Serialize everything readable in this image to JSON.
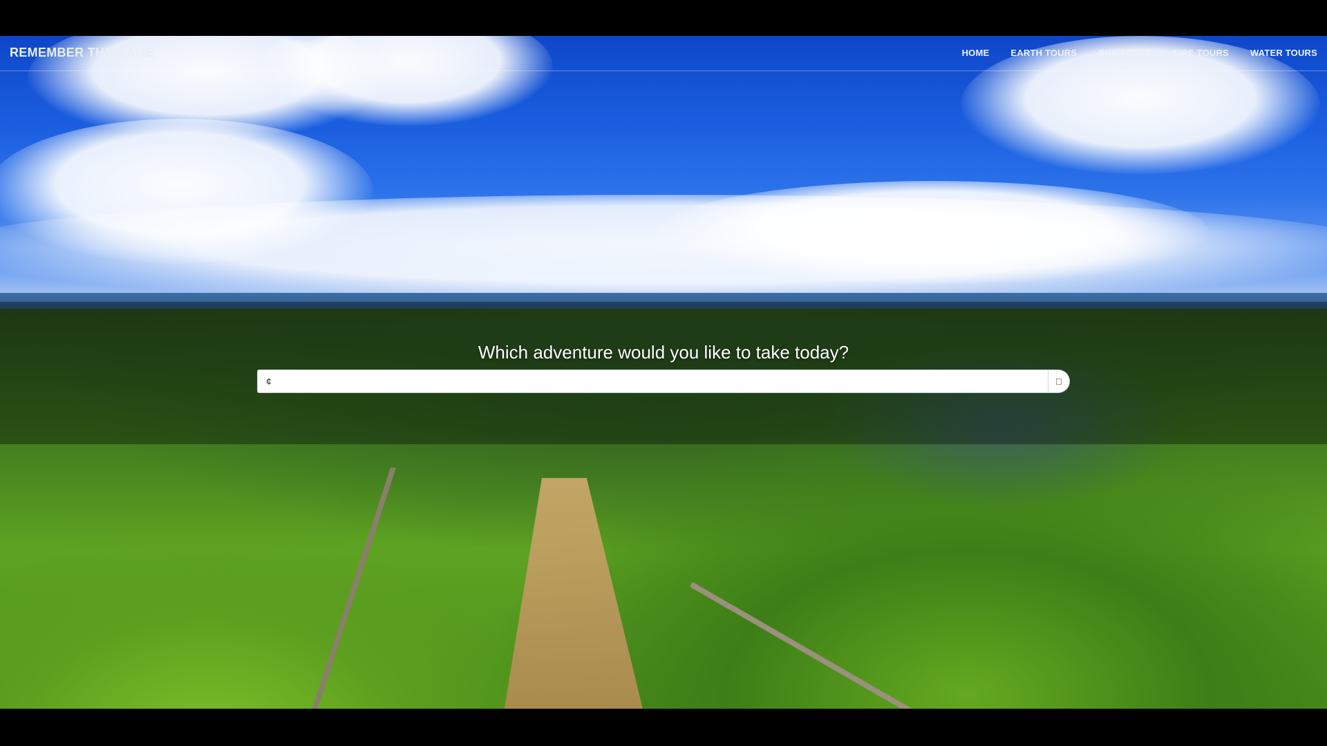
{
  "navbar": {
    "brand": "REMEMBER THE NAME",
    "links": [
      "HOME",
      "EARTH TOURS",
      "SKY TOURS",
      "FIRE TOURS",
      "WATER TOURS"
    ]
  },
  "hero": {
    "question": "Which adventure would you like to take today?"
  },
  "search": {
    "value": "¢",
    "placeholder": ""
  },
  "colors": {
    "text_light": "#eef2f8",
    "letterbox": "#000000"
  },
  "icons": {
    "search_button": "search-icon"
  }
}
